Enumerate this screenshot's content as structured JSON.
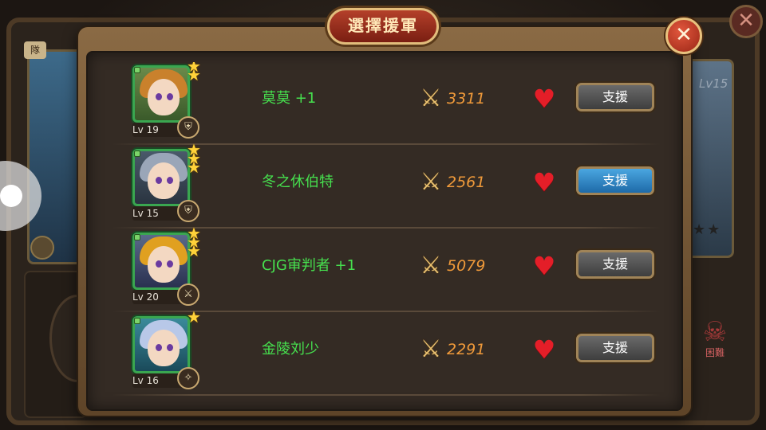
{
  "window": {
    "title": "選擇援軍",
    "close_icon": "close-icon"
  },
  "background": {
    "right_card_level": "Lv15",
    "left_label": "隊",
    "skull_label": "困難"
  },
  "rows": [
    {
      "name": "莫莫 +1",
      "level": "Lv 19",
      "power": "3311",
      "stars": 2,
      "class_icon": "shield-icon",
      "hair": "#c9812c",
      "button": "支援",
      "selected": false
    },
    {
      "name": "冬之休伯特",
      "level": "Lv 15",
      "power": "2561",
      "stars": 3,
      "class_icon": "shield-icon",
      "hair": "#9aa6b8",
      "button": "支援",
      "selected": true
    },
    {
      "name": "CJG审判者 +1",
      "level": "Lv 20",
      "power": "5079",
      "stars": 3,
      "class_icon": "sword-icon",
      "hair": "#e0a020",
      "button": "支援",
      "selected": false
    },
    {
      "name": "金陵刘少",
      "level": "Lv 16",
      "power": "2291",
      "stars": 1,
      "class_icon": "staff-icon",
      "hair": "#b8c8e8",
      "button": "支援",
      "selected": false
    }
  ],
  "colors": {
    "name": "#46e04e",
    "power": "#f09a3a",
    "heart": "#e41e28",
    "button_active": "#2e86c8",
    "button_default": "#555555"
  }
}
